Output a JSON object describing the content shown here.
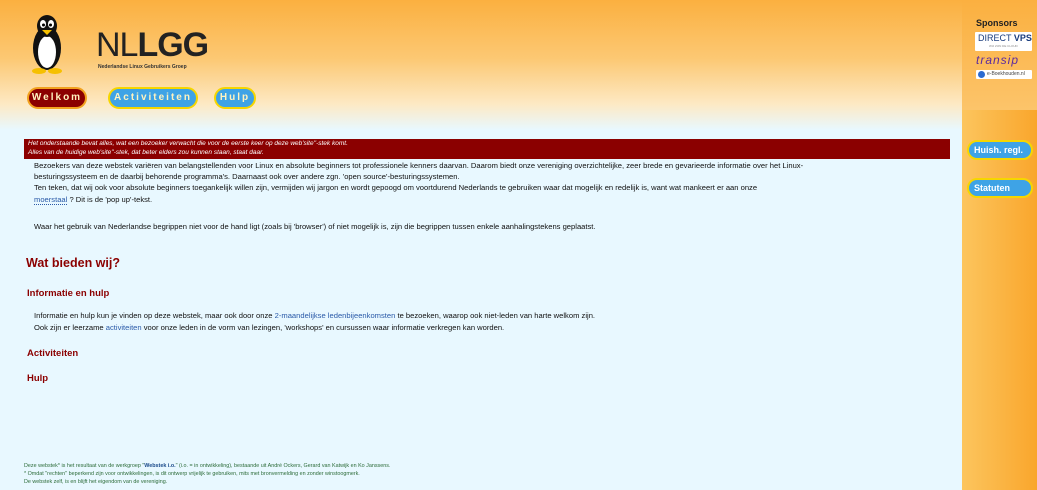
{
  "logo": {
    "text_light": "NL",
    "text_bold": "LGG",
    "subtitle": "Nederlandse Linux Gebruikers Groep"
  },
  "nav": {
    "welkom": "Welkom",
    "activiteiten": "Activiteiten",
    "hulp": "Hulp"
  },
  "sponsors": {
    "title": "Sponsors",
    "directvps_a": "DIRECT",
    "directvps_b": "VPS",
    "directvps_sub": "WIJ ZIJN DE CLOUD",
    "transip": "transip",
    "eboekhouden": "e-Boekhouden.nl"
  },
  "side_buttons": {
    "huish": "Huish. regl.",
    "statuten": "Statuten"
  },
  "notice": {
    "line1": "Het onderstaande bevat alles, wat een bezoeker verwacht die voor de eerste keer op deze web'site''-stek komt.",
    "line2": "Alles van de huidige web'site''-stek, dat beter elders zou kunnen staan, staat daar."
  },
  "intro": {
    "p1_l1": "Bezoekers van deze webstek variëren van belangstellenden voor Linux en absolute beginners tot professionele kenners daarvan. Daarom biedt onze vereniging overzichtelijke, zeer brede en gevarieerde informatie over het Linux-",
    "p1_l2": "besturingssysteem en de daarbij behorende programma's. Daarnaast ook over andere zgn. 'open source'-besturingssystemen.",
    "p1_l3": "Ten teken, dat wij ook voor absolute beginners toegankelijk willen zijn, vermijden wij jargon en wordt gepoogd om voortdurend Nederlands te gebruiken waar dat mogelijk en redelijk is, want wat mankeert er aan onze",
    "p1_link": "moerstaal",
    "p1_l4_tail": " ? Dit is de 'pop up'-tekst.",
    "p2": "Waar het gebruik van Nederlandse begrippen niet voor de hand ligt (zoals bij 'browser') of niet mogelijk is, zijn die begrippen tussen enkele aanhalingstekens geplaatst."
  },
  "sections": {
    "wat_bieden": "Wat bieden wij?",
    "info_hulp": "Informatie en hulp",
    "activiteiten": "Activiteiten",
    "hulp": "Hulp"
  },
  "info": {
    "l1_a": "Informatie en hulp kun je vinden op deze webstek, maar ook door onze ",
    "l1_link": "2-maandelijkse ledenbijeenkomsten",
    "l1_b": " te bezoeken, waarop ook niet-leden van harte welkom zijn.",
    "l2_a": "Ook zijn er leerzame ",
    "l2_link": "activiteiten",
    "l2_b": " voor onze leden in de vorm van lezingen, 'workshops' en cursussen waar informatie verkregen kan worden."
  },
  "footer": {
    "l1_a": "Deze webstek",
    "l1_b": "* is het resultaat van de werkgroep \"",
    "l1_bold": "Webstek i.o.",
    "l1_c": "\" (i.o. = in ontwikkeling), bestaande uit André Ockers, Gerard van Katwijk en Ko Janssens.",
    "l2": "* Omdat \"rechten\" beperkend zijn voor ontwikkelingen, is dit ontwerp vrijelijk te gebruiken, mits met bronvermelding en zonder winstoogmerk.",
    "l3": "De webstek zelf, is en blijft het eigendom van de vereniging."
  },
  "colors": {
    "accent_red": "#8b0000",
    "button_blue": "#3ea3e6",
    "header_orange": "#fbb040",
    "background": "#e8f8ff"
  }
}
